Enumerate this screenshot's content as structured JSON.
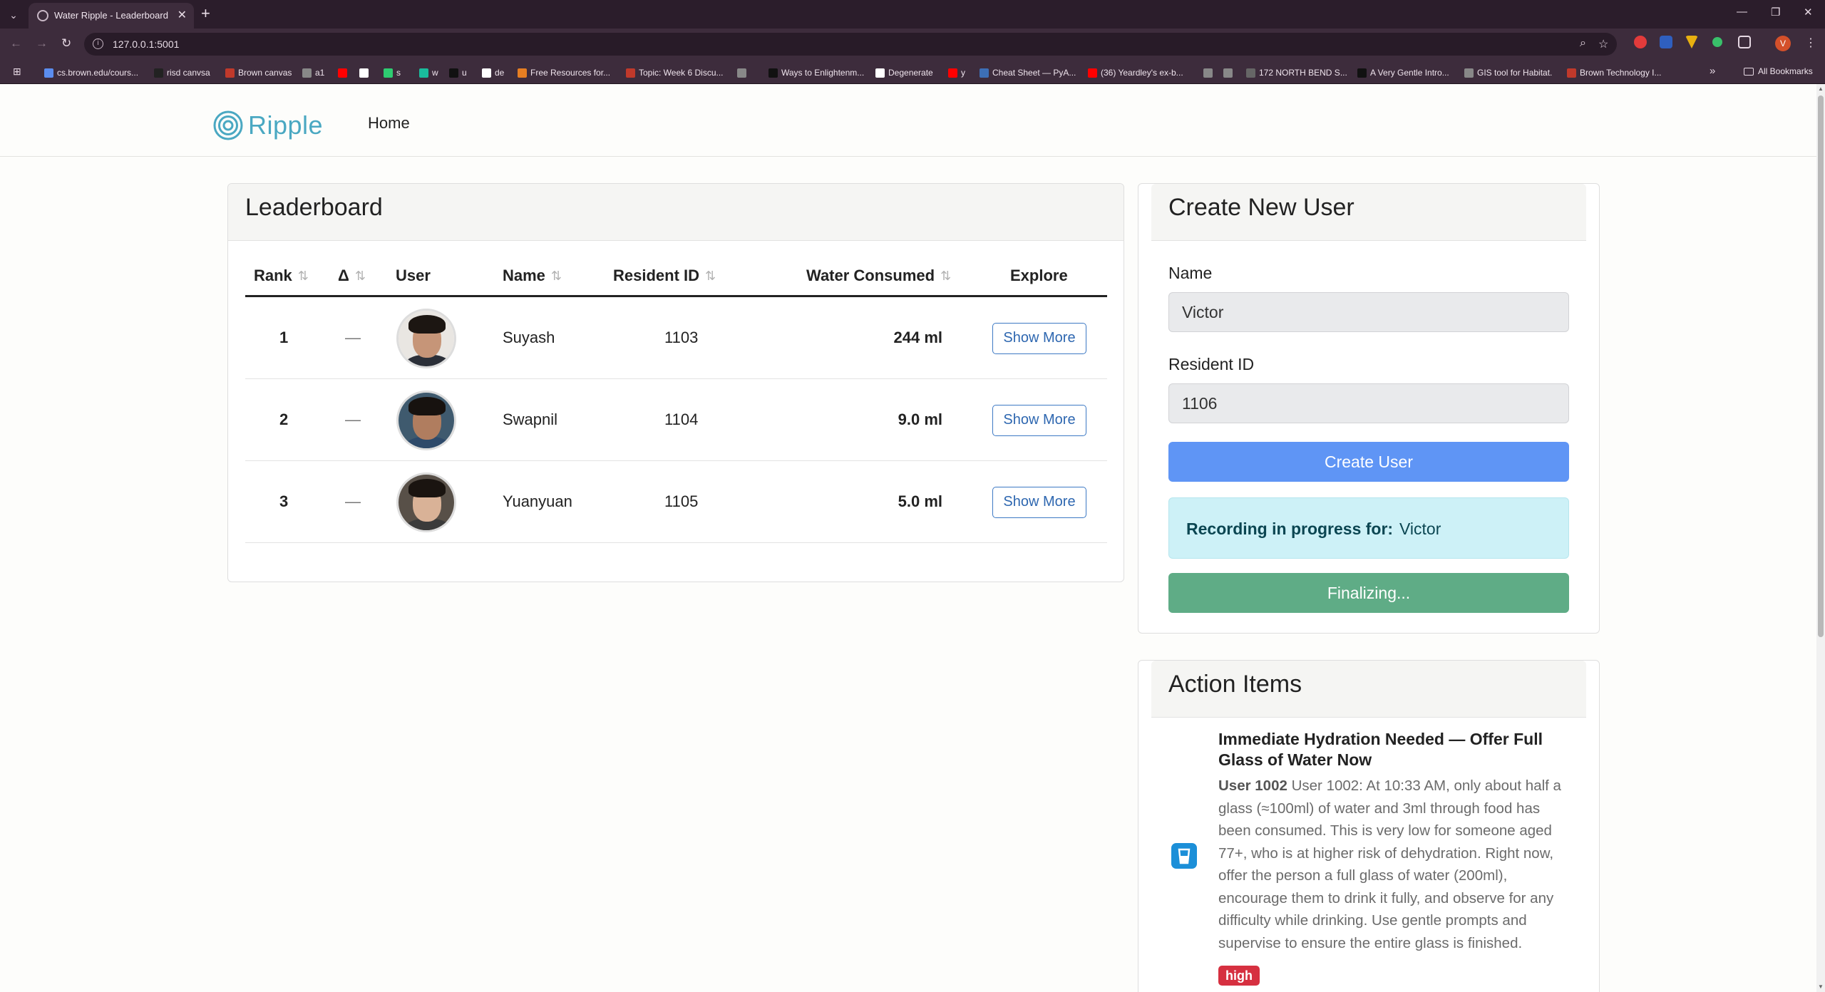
{
  "browser": {
    "tab_title": "Water Ripple - Leaderboard",
    "url": "127.0.0.1:5001",
    "profile_initial": "V",
    "bookmarks": [
      {
        "label": "cs.brown.edu/cours...",
        "color": "#5b8def"
      },
      {
        "label": "risd canvsa",
        "color": "#222222"
      },
      {
        "label": "Brown canvas",
        "color": "#c0392b"
      },
      {
        "label": "a1",
        "color": "#888888"
      },
      {
        "label": "",
        "color": "#ff0000"
      },
      {
        "label": "",
        "color": "#ffffff"
      },
      {
        "label": "s",
        "color": "#2ecc71"
      },
      {
        "label": "w",
        "color": "#1abc9c"
      },
      {
        "label": "u",
        "color": "#111111"
      },
      {
        "label": "de",
        "color": "#ffffff"
      },
      {
        "label": "Free Resources for...",
        "color": "#e67e22"
      },
      {
        "label": "Topic: Week 6 Discu...",
        "color": "#c0392b"
      },
      {
        "label": "",
        "color": "#888888"
      },
      {
        "label": "Ways to Enlightenm...",
        "color": "#111111"
      },
      {
        "label": "Degenerate",
        "color": "#ffffff"
      },
      {
        "label": "y",
        "color": "#ff0000"
      },
      {
        "label": "Cheat Sheet — PyA...",
        "color": "#3d6fb6"
      },
      {
        "label": "(36) Yeardley's ex-b...",
        "color": "#ff0000"
      },
      {
        "label": "",
        "color": "#888888"
      },
      {
        "label": "",
        "color": "#888888"
      },
      {
        "label": "172 NORTH BEND S...",
        "color": "#666666"
      },
      {
        "label": "A Very Gentle Intro...",
        "color": "#111111"
      },
      {
        "label": "GIS tool for Habitat.",
        "color": "#888888"
      },
      {
        "label": "Brown Technology I...",
        "color": "#c0392b"
      }
    ],
    "all_bookmarks_label": "All Bookmarks"
  },
  "nav": {
    "logo_text": "Ripple",
    "home_label": "Home"
  },
  "leaderboard": {
    "title": "Leaderboard",
    "columns": {
      "rank": "Rank",
      "delta": "Δ",
      "user": "User",
      "name": "Name",
      "resident_id": "Resident ID",
      "water": "Water Consumed",
      "explore": "Explore"
    },
    "rows": [
      {
        "rank": "1",
        "delta": "—",
        "name": "Suyash",
        "resident_id": "1103",
        "water": "244 ml",
        "action": "Show More",
        "bg": "#e9e6e2",
        "hair": "#1c1612",
        "skin": "#c69578",
        "shirt": "#2b2f38"
      },
      {
        "rank": "2",
        "delta": "—",
        "name": "Swapnil",
        "resident_id": "1104",
        "water": "9.0 ml",
        "action": "Show More",
        "bg": "#3f5a6e",
        "hair": "#17120f",
        "skin": "#b07d5f",
        "shirt": "#2e4a6a"
      },
      {
        "rank": "3",
        "delta": "—",
        "name": "Yuanyuan",
        "resident_id": "1105",
        "water": "5.0 ml",
        "action": "Show More",
        "bg": "#585048",
        "hair": "#1a1410",
        "skin": "#d9b297",
        "shirt": "#3b3b3b"
      }
    ]
  },
  "create_user": {
    "title": "Create New User",
    "name_label": "Name",
    "name_value": "Victor",
    "resident_label": "Resident ID",
    "resident_value": "1106",
    "create_button": "Create User",
    "recording_prefix": "Recording in progress for:",
    "recording_name": "Victor",
    "finalizing_button": "Finalizing..."
  },
  "action_items": {
    "title": "Action Items",
    "items": [
      {
        "title": "Immediate Hydration Needed — Offer Full Glass of Water Now",
        "user": "User 1002",
        "body": "User 1002: At 10:33 AM, only about half a glass (≈100ml) of water and 3ml through food has been consumed. This is very low for someone aged 77+, who is at higher risk of dehydration. Right now, offer the person a full glass of water (200ml), encourage them to drink it fully, and observe for any difficulty while drinking. Use gentle prompts and supervise to ensure the entire glass is finished.",
        "priority": "high",
        "icon": "water-glass-icon"
      }
    ]
  },
  "colors": {
    "brand": "#4aa8c2",
    "primary": "#5f95f5",
    "success": "#5fac86",
    "info_bg": "#cdf1f7",
    "danger": "#d63040"
  }
}
